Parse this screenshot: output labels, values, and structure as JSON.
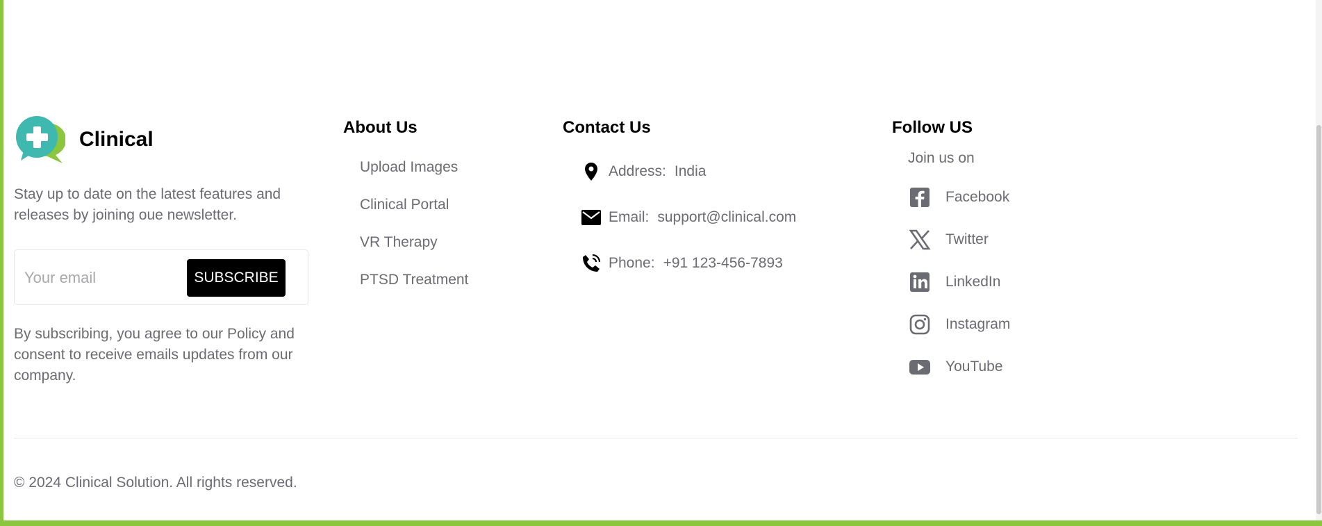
{
  "brand": {
    "name": "Clinical"
  },
  "newsletter": {
    "description": "Stay up to date on the latest features and releases by joining oue newsletter.",
    "email_placeholder": "Your email",
    "subscribe_label": "SUBSCRIBE",
    "consent": "By subscribing, you agree to our Policy and consent to receive emails updates from our company."
  },
  "about": {
    "heading": "About Us",
    "links": [
      "Upload Images",
      "Clinical Portal",
      "VR Therapy",
      "PTSD Treatment"
    ]
  },
  "contact": {
    "heading": "Contact Us",
    "address": {
      "label": "Address:",
      "value": "India",
      "icon": "location-pin-icon"
    },
    "email": {
      "label": "Email:",
      "value": "support@clinical.com",
      "icon": "envelope-icon"
    },
    "phone": {
      "label": "Phone:",
      "value": "+91 123-456-7893",
      "icon": "phone-icon"
    }
  },
  "follow": {
    "heading": "Follow US",
    "join_text": "Join us on",
    "links": [
      {
        "label": "Facebook",
        "icon": "facebook-icon"
      },
      {
        "label": "Twitter",
        "icon": "x-twitter-icon"
      },
      {
        "label": "LinkedIn",
        "icon": "linkedin-icon"
      },
      {
        "label": "Instagram",
        "icon": "instagram-icon"
      },
      {
        "label": "YouTube",
        "icon": "youtube-icon"
      }
    ]
  },
  "footer": {
    "copyright": "© 2024 Clinical Solution. All rights reserved."
  },
  "colors": {
    "accent": "#8cc63f",
    "logo_teal": "#3fb8af",
    "text_muted": "#6b6b74",
    "heading": "#000000"
  }
}
